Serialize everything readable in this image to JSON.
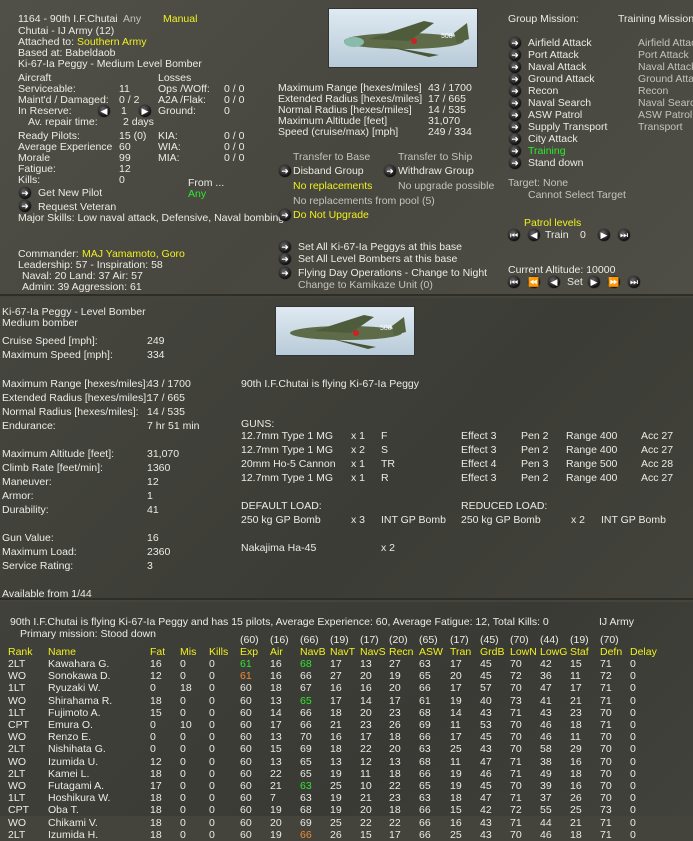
{
  "header": {
    "unit": "1164 - 90th I.F.Chutai",
    "any": "Any",
    "mode": "Manual",
    "type": "Chutai - IJ Army (12)",
    "attached_label": "Attached to:",
    "attached": "Southern Army",
    "based": "Based at: Babeldaob",
    "aircraft": "Ki-67-Ia Peggy - Medium Level Bomber"
  },
  "aircraft": {
    "heading": "Aircraft",
    "losses_heading": "Losses",
    "serviceable_l": "Serviceable:",
    "serviceable": "11",
    "maint_l": "Maint'd / Damaged:",
    "maint": "0 / 2",
    "reserve_l": "In Reserve:",
    "reserve": "1",
    "repair_l": "Av. repair time:",
    "repair": "2 days",
    "ops_l": "Ops /WOff:",
    "ops": "0 / 0",
    "a2a_l": "A2A /Flak:",
    "a2a": "0 / 0",
    "ground_l": "Ground:",
    "ground": "0",
    "ready_l": "Ready Pilots:",
    "ready": "15 (0)",
    "exp_l": "Average Experience",
    "exp": "60",
    "morale_l": "Morale",
    "morale": "99",
    "fatigue_l": "Fatigue:",
    "fatigue": "12",
    "kills_l": "Kills:",
    "kills": "0",
    "kia_l": "KIA:",
    "kia": "0 / 0",
    "wia_l": "WIA:",
    "wia": "0 / 0",
    "mia_l": "MIA:",
    "mia": "0 / 0",
    "from_l": "From ...",
    "from": "Any",
    "get_pilot": "Get New Pilot",
    "veteran": "Request Veteran",
    "skills": "Major Skills: Low naval attack, Defensive, Naval bombing"
  },
  "commander": {
    "label": "Commander:",
    "name": "MAJ Yamamoto, Goro",
    "leadership": "Leadership: 57 - Inspiration: 58",
    "skills1": "Naval: 20  Land: 37  Air: 57",
    "skills2": "Admin: 39  Aggression: 61"
  },
  "perf": [
    [
      "Maximum Range [hexes/miles]",
      "43 / 1700"
    ],
    [
      "Extended Radius [hexes/miles]",
      "17 / 665"
    ],
    [
      "Normal Radius [hexes/miles]",
      "14 / 535"
    ],
    [
      "Maximum Altitude [feet]",
      "31,070"
    ],
    [
      "Speed (cruise/max) [mph]",
      "249 / 334"
    ]
  ],
  "actions": {
    "transfer_base": "Transfer to Base",
    "transfer_ship": "Transfer to Ship",
    "disband": "Disband Group",
    "withdraw": "Withdraw Group",
    "no_repl": "No replacements",
    "no_upgrade": "No upgrade possible",
    "pool": "No replacements from pool (5)",
    "do_not_upgrade": "Do Not Upgrade",
    "set_all_type": "Set All Ki-67-Ia Peggys at this base",
    "set_all_role": "Set All Level Bombers at this base",
    "flying": "Flying Day Operations - Change to Night",
    "kamikaze": "Change to Kamikaze Unit (0)"
  },
  "missions": {
    "title": "Group Mission:",
    "training_title": "Training Mission",
    "items": [
      "Airfield Attack",
      "Port Attack",
      "Naval Attack",
      "Ground Attack",
      "Recon",
      "Naval Search",
      "ASW Patrol",
      "Supply Transport",
      "City Attack",
      "Training",
      "Stand down"
    ],
    "active": "Training",
    "training_items": [
      "Airfield Attack",
      "Port Attack",
      "Naval Attack",
      "Ground Attack",
      "Recon",
      "Naval Search",
      "ASW Patrol",
      "Transport"
    ],
    "target": "Target: None",
    "cannot": "Cannot Select Target",
    "patrol": "Patrol levels",
    "train": "Train",
    "train_value": "0",
    "altitude": "Current Altitude: 10000",
    "set": "Set"
  },
  "spec": {
    "title": "Ki-67-Ia Peggy - Level Bomber",
    "subtitle": "Medium bomber",
    "groups": [
      [
        [
          "Cruise Speed [mph]:",
          "249"
        ],
        [
          "Maximum Speed [mph]:",
          "334"
        ]
      ],
      [
        [
          "Maximum Range [hexes/miles]:",
          "43 / 1700"
        ],
        [
          "Extended Radius [hexes/miles]:",
          "17 / 665"
        ],
        [
          "Normal Radius [hexes/miles]:",
          "14 / 535"
        ],
        [
          "Endurance:",
          "7 hr 51 min"
        ]
      ],
      [
        [
          "Maximum Altitude [feet]:",
          "31,070"
        ],
        [
          "Climb Rate [feet/min]:",
          "1360"
        ],
        [
          "Maneuver:",
          "12"
        ],
        [
          "Armor:",
          "1"
        ],
        [
          "Durability:",
          "41"
        ]
      ],
      [
        [
          "Gun Value:",
          "16"
        ],
        [
          "Maximum Load:",
          "2360"
        ],
        [
          "Service Rating:",
          "3"
        ]
      ]
    ],
    "available": "Available from  1/44",
    "flying": "90th I.F.Chutai is flying Ki-67-Ia Peggy",
    "guns_title": "GUNS:",
    "guns": [
      [
        "12.7mm Type 1 MG",
        "x 1",
        "F",
        "Effect 3",
        "Pen 2",
        "Range 400",
        "Acc 27"
      ],
      [
        "12.7mm Type 1 MG",
        "x 2",
        "S",
        "Effect 3",
        "Pen 2",
        "Range 400",
        "Acc 27"
      ],
      [
        "20mm Ho-5 Cannon",
        "x 1",
        "TR",
        "Effect 4",
        "Pen 3",
        "Range 500",
        "Acc 28"
      ],
      [
        "12.7mm Type 1 MG",
        "x 1",
        "R",
        "Effect 3",
        "Pen 2",
        "Range 400",
        "Acc 27"
      ]
    ],
    "default_title": "DEFAULT LOAD:",
    "default": [
      "250 kg GP Bomb",
      "x 3",
      "INT  GP Bomb"
    ],
    "reduced_title": "REDUCED LOAD:",
    "reduced": [
      "250 kg GP Bomb",
      "x 2",
      "INT  GP Bomb"
    ],
    "engine": "Nakajima Ha-45",
    "engine_qty": "x 2"
  },
  "pilots": {
    "summary": "90th I.F.Chutai is flying Ki-67-Ia Peggy and has 15 pilots,  Average Experience: 60, Average Fatigue: 12, Total Kills: 0",
    "service": "IJ Army",
    "primary": "Primary mission: Stood down",
    "columns": [
      "Rank",
      "Name",
      "Fat",
      "Mis",
      "Kills",
      "Exp",
      "Air",
      "NavB",
      "NavT",
      "NavS",
      "Recn",
      "ASW",
      "Tran",
      "GrdB",
      "LowN",
      "LowG",
      "Staf",
      "Defn",
      "Delay"
    ],
    "averages": [
      "",
      "",
      "",
      "",
      "",
      "(60)",
      "(16)",
      "(66)",
      "(19)",
      "(17)",
      "(20)",
      "(65)",
      "(17)",
      "(45)",
      "(70)",
      "(44)",
      "(19)",
      "(70)",
      ""
    ],
    "rows": [
      [
        "2LT",
        "Kawahara G.",
        "16",
        "0",
        "0",
        "61",
        "16",
        "68",
        "17",
        "13",
        "27",
        "63",
        "17",
        "45",
        "70",
        "42",
        "15",
        "71",
        "0"
      ],
      [
        "WO",
        "Sonokawa D.",
        "12",
        "0",
        "0",
        "61",
        "16",
        "66",
        "27",
        "20",
        "19",
        "65",
        "20",
        "45",
        "72",
        "36",
        "11",
        "72",
        "0"
      ],
      [
        "1LT",
        "Ryuzaki W.",
        "0",
        "18",
        "0",
        "60",
        "18",
        "67",
        "16",
        "16",
        "20",
        "66",
        "17",
        "57",
        "70",
        "47",
        "17",
        "71",
        "0"
      ],
      [
        "WO",
        "Shirahama R.",
        "18",
        "0",
        "0",
        "60",
        "13",
        "65",
        "17",
        "14",
        "17",
        "61",
        "19",
        "40",
        "73",
        "41",
        "21",
        "71",
        "0"
      ],
      [
        "1LT",
        "Fujimoto A.",
        "15",
        "0",
        "0",
        "60",
        "14",
        "66",
        "18",
        "20",
        "23",
        "68",
        "14",
        "43",
        "71",
        "43",
        "23",
        "70",
        "0"
      ],
      [
        "CPT",
        "Emura O.",
        "0",
        "10",
        "0",
        "60",
        "17",
        "66",
        "21",
        "23",
        "26",
        "69",
        "11",
        "53",
        "70",
        "46",
        "18",
        "71",
        "0"
      ],
      [
        "WO",
        "Renzo E.",
        "0",
        "0",
        "0",
        "60",
        "13",
        "70",
        "16",
        "17",
        "18",
        "66",
        "17",
        "45",
        "70",
        "46",
        "11",
        "70",
        "0"
      ],
      [
        "2LT",
        "Nishihata G.",
        "0",
        "0",
        "0",
        "60",
        "15",
        "69",
        "18",
        "22",
        "20",
        "63",
        "25",
        "43",
        "70",
        "58",
        "29",
        "70",
        "0"
      ],
      [
        "WO",
        "Izumida U.",
        "12",
        "0",
        "0",
        "60",
        "13",
        "65",
        "13",
        "12",
        "13",
        "68",
        "11",
        "47",
        "71",
        "38",
        "16",
        "70",
        "0"
      ],
      [
        "2LT",
        "Kamei L.",
        "18",
        "0",
        "0",
        "60",
        "22",
        "65",
        "19",
        "11",
        "18",
        "66",
        "19",
        "46",
        "71",
        "49",
        "18",
        "70",
        "0"
      ],
      [
        "WO",
        "Futagami A.",
        "17",
        "0",
        "0",
        "60",
        "21",
        "63",
        "25",
        "10",
        "22",
        "65",
        "19",
        "45",
        "70",
        "39",
        "16",
        "70",
        "0"
      ],
      [
        "1LT",
        "Hoshikura W.",
        "18",
        "0",
        "0",
        "60",
        "7",
        "63",
        "19",
        "21",
        "23",
        "63",
        "18",
        "47",
        "71",
        "37",
        "26",
        "70",
        "0"
      ],
      [
        "CPT",
        "Oba T.",
        "18",
        "0",
        "0",
        "60",
        "19",
        "68",
        "19",
        "20",
        "18",
        "66",
        "15",
        "42",
        "72",
        "55",
        "25",
        "73",
        "0"
      ],
      [
        "WO",
        "Chikami V.",
        "18",
        "0",
        "0",
        "60",
        "20",
        "69",
        "25",
        "22",
        "22",
        "66",
        "16",
        "43",
        "71",
        "44",
        "21",
        "71",
        "0"
      ],
      [
        "2LT",
        "Izumida H.",
        "18",
        "0",
        "0",
        "60",
        "19",
        "66",
        "26",
        "15",
        "17",
        "66",
        "25",
        "43",
        "70",
        "46",
        "18",
        "71",
        "0"
      ]
    ],
    "highlights": [
      [
        0,
        5,
        "#2ee82e"
      ],
      [
        0,
        7,
        "#2ee82e"
      ],
      [
        1,
        5,
        "#f08a30"
      ],
      [
        3,
        7,
        "#2ee82e"
      ],
      [
        10,
        7,
        "#2ee82e"
      ],
      [
        14,
        7,
        "#f08a30"
      ]
    ]
  },
  "colors": {
    "yellow": "#f0f020",
    "green": "#2ee82e",
    "orange": "#f08a30"
  }
}
